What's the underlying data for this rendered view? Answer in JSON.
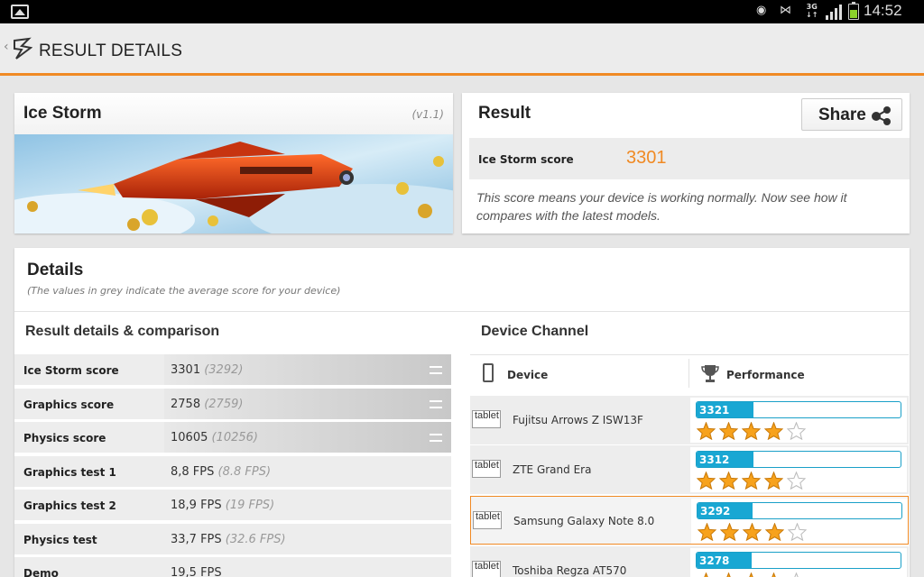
{
  "status_bar": {
    "time": "14:52",
    "network": "3G"
  },
  "app_bar": {
    "title": "RESULT DETAILS"
  },
  "benchmark": {
    "name": "Ice Storm",
    "version": "(v1.1)"
  },
  "result": {
    "title": "Result",
    "share_label": "Share",
    "score_label": "Ice Storm score",
    "score_value": "3301",
    "note": "This score means your device is working normally. Now see how it compares with the latest models."
  },
  "details": {
    "title": "Details",
    "subtitle": "(The values in grey indicate the average score for your device)",
    "comparison_title": "Result details & comparison",
    "rows": [
      {
        "label": "Ice Storm score",
        "value": "3301",
        "avg": "(3292)",
        "expandable": true
      },
      {
        "label": "Graphics score",
        "value": "2758",
        "avg": "(2759)",
        "expandable": true
      },
      {
        "label": "Physics score",
        "value": "10605",
        "avg": "(10256)",
        "expandable": true
      },
      {
        "label": "Graphics test 1",
        "value": "8,8 FPS",
        "avg": "(8.8 FPS)",
        "expandable": false
      },
      {
        "label": "Graphics test 2",
        "value": "18,9 FPS",
        "avg": "(19 FPS)",
        "expandable": false
      },
      {
        "label": "Physics test",
        "value": "33,7 FPS",
        "avg": "(32.6 FPS)",
        "expandable": false
      },
      {
        "label": "Demo",
        "value": "19,5 FPS",
        "avg": "",
        "expandable": false
      }
    ]
  },
  "device_channel": {
    "title": "Device Channel",
    "col_device": "Device",
    "col_performance": "Performance",
    "devices": [
      {
        "type": "tablet",
        "name": "Fujitsu Arrows Z ISW13F",
        "score": "3321",
        "fill": 0.28,
        "stars": 4,
        "highlighted": false
      },
      {
        "type": "tablet",
        "name": "ZTE Grand Era",
        "score": "3312",
        "fill": 0.28,
        "stars": 4,
        "highlighted": false
      },
      {
        "type": "tablet",
        "name": "Samsung Galaxy Note 8.0",
        "score": "3292",
        "fill": 0.27,
        "stars": 4,
        "highlighted": true
      },
      {
        "type": "tablet",
        "name": "Toshiba Regza AT570",
        "score": "3278",
        "fill": 0.27,
        "stars": 4,
        "highlighted": false
      }
    ]
  },
  "colors": {
    "accent": "#f08a24",
    "bar": "#19a7d3",
    "star": "#f7a21c"
  }
}
